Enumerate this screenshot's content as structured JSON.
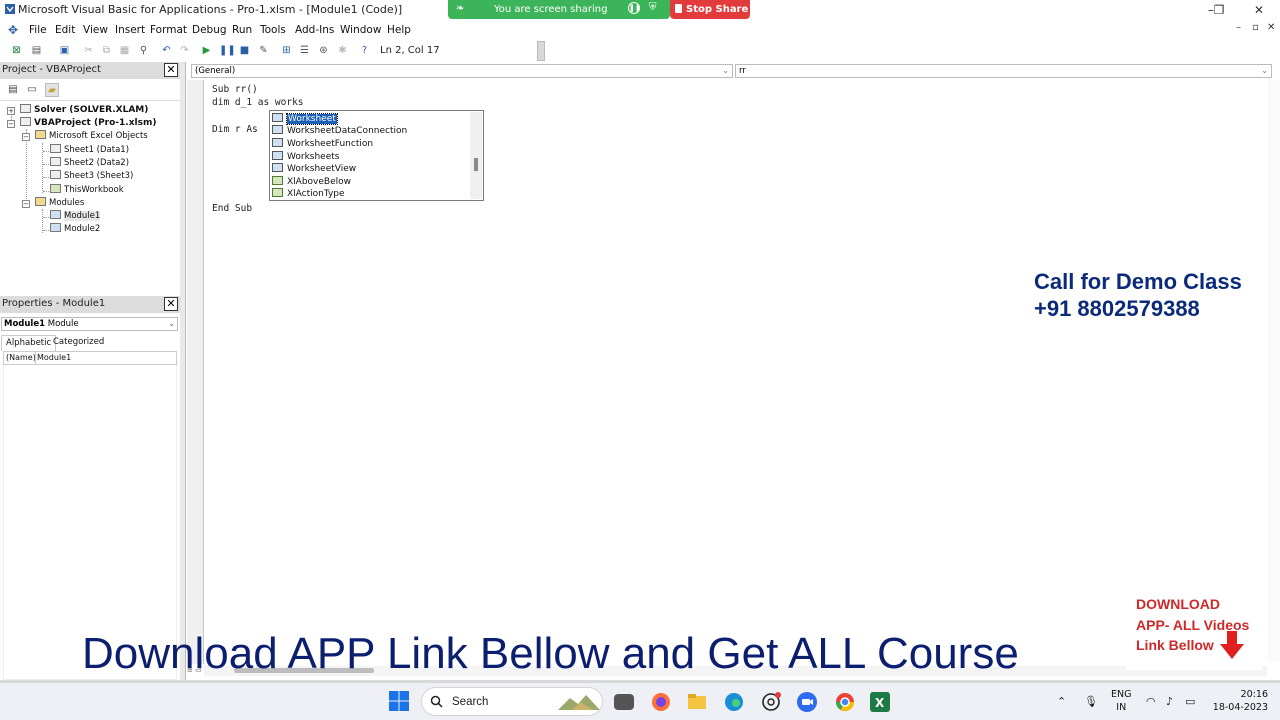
{
  "window": {
    "title": "Microsoft Visual Basic for Applications - Pro-1.xlsm - [Module1 (Code)]",
    "controls": {
      "minimize": "–",
      "maximize": "❐",
      "close": "✕"
    }
  },
  "screen_share": {
    "status": "You are screen sharing",
    "stop_label": "Stop Share",
    "colors": {
      "bar": "#3cb55a",
      "stop": "#e33b3b"
    }
  },
  "menu": {
    "items": [
      "File",
      "Edit",
      "View",
      "Insert",
      "Format",
      "Debug",
      "Run",
      "Tools",
      "Add-Ins",
      "Window",
      "Help"
    ],
    "mdi_controls": {
      "minimize": "–",
      "restore": "▫",
      "close": "✕"
    }
  },
  "toolbar": {
    "position": "Ln 2, Col 17"
  },
  "project": {
    "title": "Project - VBAProject",
    "close": "✕",
    "tree": [
      {
        "label": "Solver (SOLVER.XLAM)"
      },
      {
        "label": "VBAProject (Pro-1.xlsm)"
      },
      {
        "label": "Microsoft Excel Objects"
      },
      {
        "label": "Sheet1 (Data1)"
      },
      {
        "label": "Sheet2 (Data2)"
      },
      {
        "label": "Sheet3 (Sheet3)"
      },
      {
        "label": "ThisWorkbook"
      },
      {
        "label": "Modules"
      },
      {
        "label": "Module1"
      },
      {
        "label": "Module2"
      }
    ]
  },
  "properties": {
    "title": "Properties - Module1",
    "close": "✕",
    "object_name": "Module1",
    "object_type": "Module",
    "tabs": [
      "Alphabetic",
      "Categorized"
    ],
    "rows": [
      {
        "name": "(Name)",
        "value": "Module1"
      }
    ]
  },
  "code": {
    "object_combo": "(General)",
    "procedure_combo": "rr",
    "lines": [
      "Sub rr()",
      "dim d_1 as works",
      "",
      "Dim r As",
      "",
      "",
      "",
      "",
      "",
      "End Sub"
    ]
  },
  "intellisense": {
    "items": [
      {
        "label": "Worksheet",
        "kind": "class",
        "selected": true
      },
      {
        "label": "WorksheetDataConnection",
        "kind": "class"
      },
      {
        "label": "WorksheetFunction",
        "kind": "class"
      },
      {
        "label": "Worksheets",
        "kind": "class"
      },
      {
        "label": "WorksheetView",
        "kind": "class"
      },
      {
        "label": "XlAboveBelow",
        "kind": "enum"
      },
      {
        "label": "XlActionType",
        "kind": "enum"
      }
    ],
    "colors": {
      "selection": "#1c5fb8"
    }
  },
  "overlays": {
    "call_line1": "Call for Demo Class",
    "call_line2": "+91 8802579388",
    "banner": "Download APP Link Bellow and Get ALL Course",
    "download_line1": "DOWNLOAD",
    "download_line2": "APP- ALL Videos",
    "download_line3": "Link Bellow",
    "colors": {
      "navy": "#0c2a7a",
      "red": "#cc2a2a"
    }
  },
  "taskbar": {
    "search_label": "Search",
    "apps": [
      "file-explorer-icon",
      "firefox-icon",
      "folder-icon",
      "edge-icon",
      "chatgpt-icon",
      "zoom-icon",
      "chrome-icon",
      "excel-icon"
    ],
    "lang_line1": "ENG",
    "lang_line2": "IN",
    "time": "20:16",
    "date": "18-04-2023"
  }
}
